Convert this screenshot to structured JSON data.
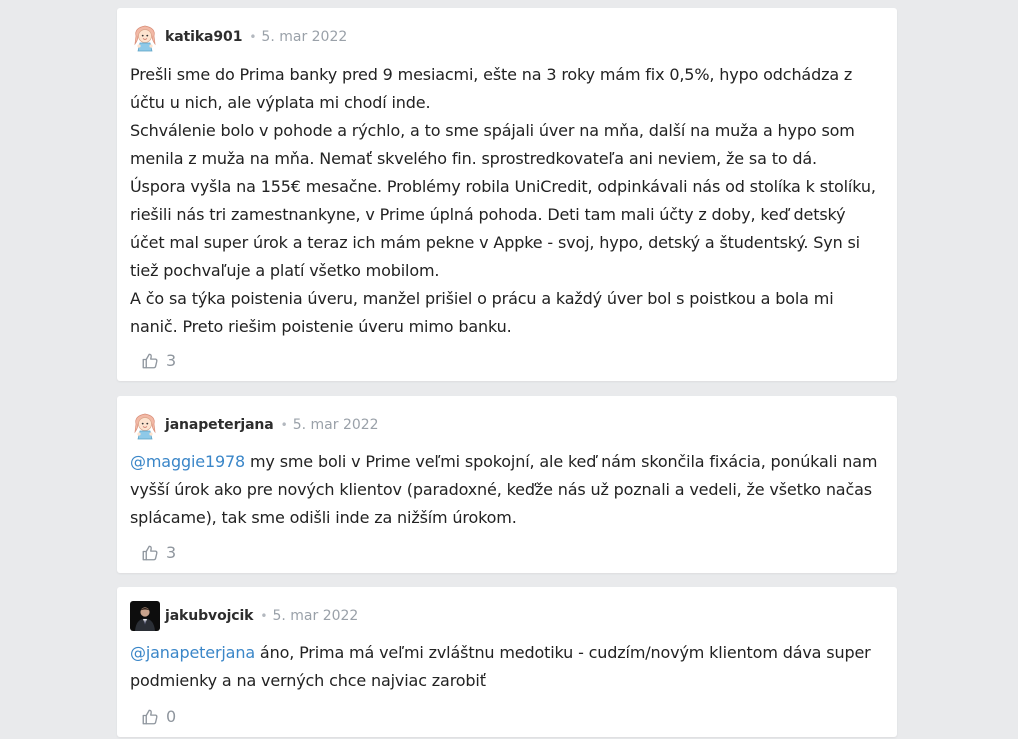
{
  "comments": [
    {
      "username": "katika901",
      "date": "5. mar 2022",
      "avatar_icon": "girl-avatar-icon",
      "paragraphs": [
        "Prešli sme do Prima banky pred 9 mesiacmi, ešte na 3 roky mám fix 0,5%, hypo odchádza z účtu u nich, ale výplata mi chodí inde.",
        "Schválenie bolo v pohode a rýchlo, a to sme spájali úver na mňa, další na muža a hypo som menila z muža na mňa. Nemať skvelého fin. sprostredkovateľa ani neviem, že sa to dá.",
        "Úspora vyšla na 155€ mesačne. Problémy robila UniCredit, odpinkávali nás od stolíka k stolíku, riešili nás tri zamestnankyne, v Prime úplná pohoda. Deti tam mali účty z doby, keď detský účet mal super úrok a teraz ich mám pekne v Appke - svoj, hypo, detský a študentský. Syn si tiež pochvaľuje a platí všetko mobilom.",
        "A čo sa týka poistenia úveru, manžel prišiel o prácu a každý úver bol s poistkou a bola mi nanič. Preto riešim poistenie úveru mimo banku."
      ],
      "likes": "3"
    },
    {
      "username": "janapeterjana",
      "date": "5. mar 2022",
      "avatar_icon": "girl-avatar-icon",
      "mention": "@maggie1978",
      "text": " my sme boli v Prime veľmi spokojní, ale keď nám skončila fixácia, ponúkali nam vyšší úrok ako pre nových klientov (paradoxné, keďže nás už poznali a vedeli, že všetko načas splácame), tak sme odišli inde za nižším úrokom.",
      "likes": "3"
    },
    {
      "username": "jakubvojcik",
      "date": "5. mar 2022",
      "avatar_icon": "man-photo-avatar-icon",
      "mention": "@janapeterjana",
      "text": " áno, Prima má veľmi zvláštnu medotiku - cudzím/novým klientom dáva super podmienky a na verných chce najviac zarobiť",
      "likes": "0"
    }
  ],
  "separator": "•",
  "colors": {
    "background": "#e9eaec",
    "card": "#ffffff",
    "mention": "#3a86c8",
    "date": "#9aa1a9",
    "likes": "#8f969e"
  }
}
